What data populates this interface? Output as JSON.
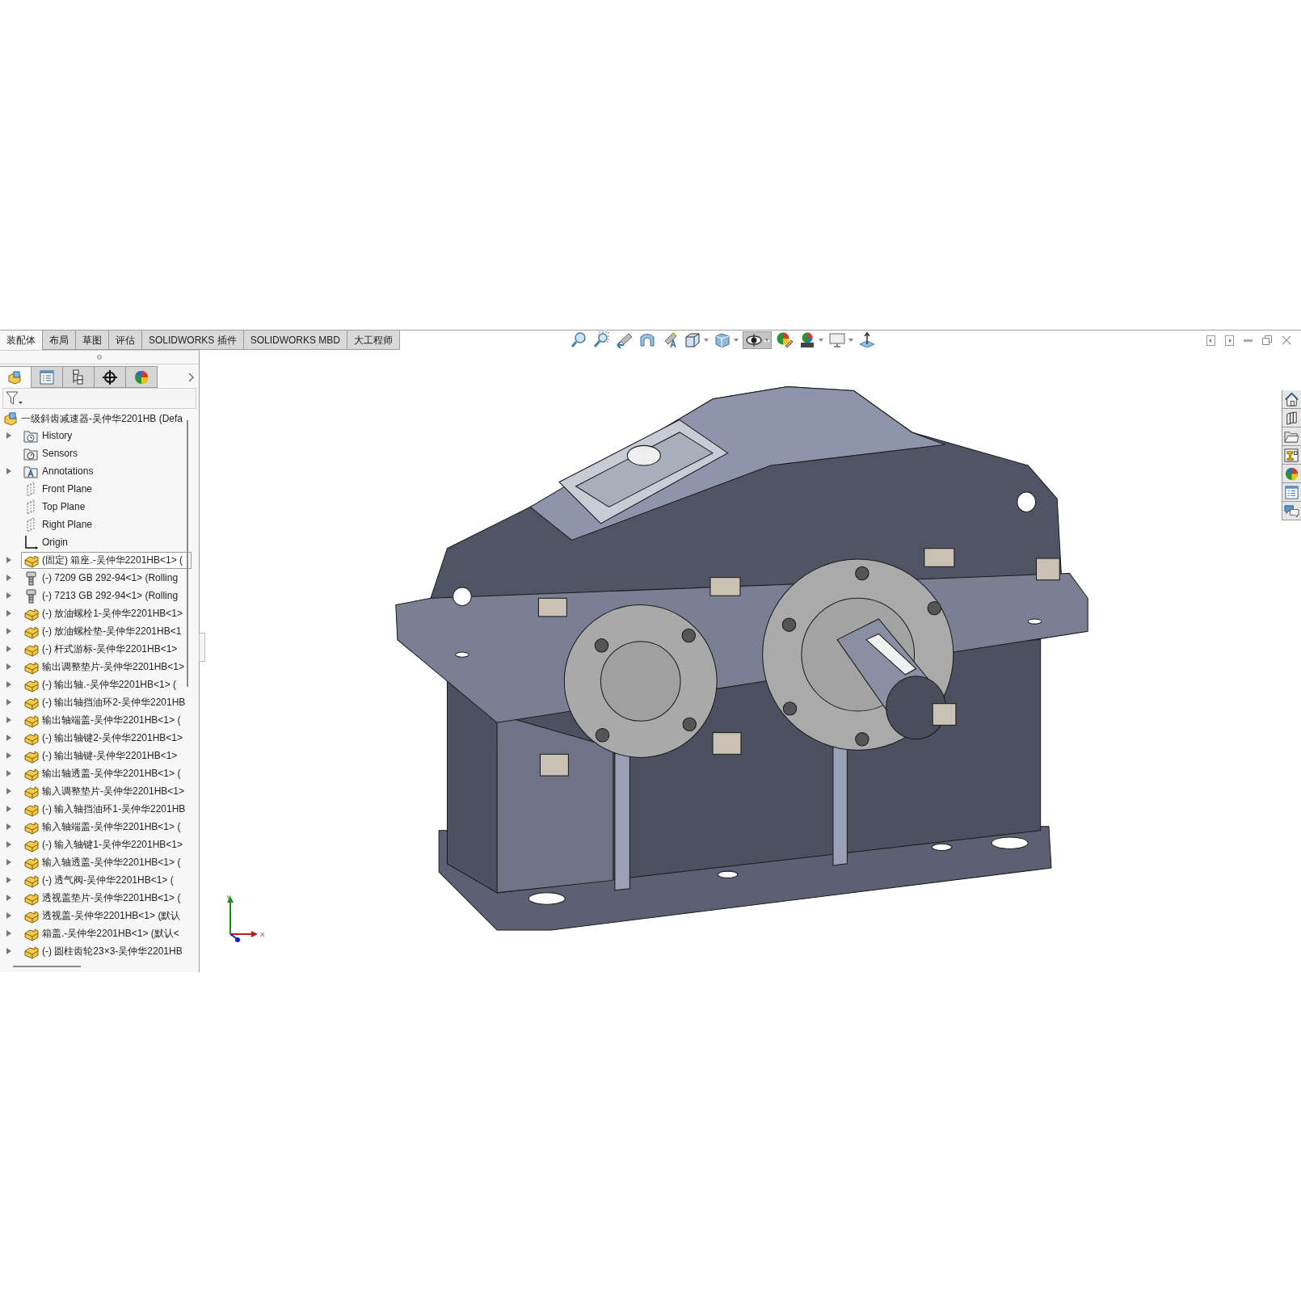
{
  "ribbon_tabs": [
    {
      "label": "装配体",
      "selected": true
    },
    {
      "label": "布局",
      "selected": false
    },
    {
      "label": "草图",
      "selected": false
    },
    {
      "label": "评估",
      "selected": false
    },
    {
      "label": "SOLIDWORKS 插件",
      "selected": false
    },
    {
      "label": "SOLIDWORKS MBD",
      "selected": false
    },
    {
      "label": "大工程师",
      "selected": false
    }
  ],
  "view_toolbar": [
    {
      "kind": "zoom-fit",
      "dropdown": false,
      "pressed": false
    },
    {
      "kind": "zoom-area",
      "dropdown": false,
      "pressed": false
    },
    {
      "kind": "previous-view",
      "dropdown": false,
      "pressed": false
    },
    {
      "kind": "section-view",
      "dropdown": false,
      "pressed": false
    },
    {
      "kind": "annotation-view",
      "dropdown": false,
      "pressed": false
    },
    {
      "kind": "view-orientation",
      "dropdown": true,
      "pressed": false
    },
    {
      "kind": "display-style",
      "dropdown": true,
      "pressed": false
    },
    {
      "kind": "hide-show",
      "dropdown": true,
      "pressed": true
    },
    {
      "kind": "edit-appearance",
      "dropdown": false,
      "pressed": false
    },
    {
      "kind": "apply-scene",
      "dropdown": true,
      "pressed": false
    },
    {
      "kind": "view-settings",
      "dropdown": true,
      "pressed": false
    },
    {
      "kind": "normal-to",
      "dropdown": false,
      "pressed": false
    }
  ],
  "panel_tabs": [
    {
      "kind": "feature-tree",
      "selected": true
    },
    {
      "kind": "property",
      "selected": false
    },
    {
      "kind": "configuration",
      "selected": false
    },
    {
      "kind": "dimxpert",
      "selected": false
    },
    {
      "kind": "display",
      "selected": false
    }
  ],
  "tree": {
    "label": "一级斜齿减速器-吴仲华2201HB (Defa",
    "kind": "assembly",
    "children": [
      {
        "label": "History",
        "kind": "history",
        "expandable": true,
        "selected": false
      },
      {
        "label": "Sensors",
        "kind": "sensors",
        "expandable": false,
        "selected": false
      },
      {
        "label": "Annotations",
        "kind": "annotations",
        "expandable": true,
        "selected": false
      },
      {
        "label": "Front Plane",
        "kind": "plane",
        "expandable": false,
        "selected": false
      },
      {
        "label": "Top Plane",
        "kind": "plane",
        "expandable": false,
        "selected": false
      },
      {
        "label": "Right Plane",
        "kind": "plane",
        "expandable": false,
        "selected": false
      },
      {
        "label": "Origin",
        "kind": "origin",
        "expandable": false,
        "selected": false
      },
      {
        "label": "(固定) 箱座.-吴仲华2201HB<1> (",
        "kind": "part",
        "expandable": true,
        "selected": true
      },
      {
        "label": "(-) 7209 GB 292-94<1> (Rolling",
        "kind": "bearing",
        "expandable": true,
        "selected": false
      },
      {
        "label": "(-) 7213 GB 292-94<1> (Rolling",
        "kind": "bearing",
        "expandable": true,
        "selected": false
      },
      {
        "label": "(-) 放油螺栓1-吴仲华2201HB<1>",
        "kind": "part",
        "expandable": true,
        "selected": false
      },
      {
        "label": "(-) 放油螺栓垫-吴仲华2201HB<1",
        "kind": "part",
        "expandable": true,
        "selected": false
      },
      {
        "label": "(-) 杆式游标-吴仲华2201HB<1>",
        "kind": "part",
        "expandable": true,
        "selected": false
      },
      {
        "label": "输出调整垫片-吴仲华2201HB<1>",
        "kind": "part",
        "expandable": true,
        "selected": false
      },
      {
        "label": "(-) 输出轴.-吴仲华2201HB<1> (",
        "kind": "part",
        "expandable": true,
        "selected": false
      },
      {
        "label": "(-) 输出轴挡油环2-吴仲华2201HB",
        "kind": "part",
        "expandable": true,
        "selected": false
      },
      {
        "label": "输出轴端盖-吴仲华2201HB<1> (",
        "kind": "part",
        "expandable": true,
        "selected": false
      },
      {
        "label": "(-) 输出轴键2-吴仲华2201HB<1>",
        "kind": "part",
        "expandable": true,
        "selected": false
      },
      {
        "label": "(-) 输出轴键-吴仲华2201HB<1>",
        "kind": "part",
        "expandable": true,
        "selected": false
      },
      {
        "label": "输出轴透盖-吴仲华2201HB<1> (",
        "kind": "part",
        "expandable": true,
        "selected": false
      },
      {
        "label": "输入调整垫片-吴仲华2201HB<1>",
        "kind": "part",
        "expandable": true,
        "selected": false
      },
      {
        "label": "(-) 输入轴挡油环1-吴仲华2201HB",
        "kind": "part",
        "expandable": true,
        "selected": false
      },
      {
        "label": "输入轴端盖-吴仲华2201HB<1> (",
        "kind": "part",
        "expandable": true,
        "selected": false
      },
      {
        "label": "(-) 输入轴键1-吴仲华2201HB<1>",
        "kind": "part",
        "expandable": true,
        "selected": false
      },
      {
        "label": "输入轴透盖-吴仲华2201HB<1> (",
        "kind": "part",
        "expandable": true,
        "selected": false
      },
      {
        "label": "(-) 透气阀-吴仲华2201HB<1> (",
        "kind": "part",
        "expandable": true,
        "selected": false
      },
      {
        "label": "透视盖垫片-吴仲华2201HB<1> (",
        "kind": "part",
        "expandable": true,
        "selected": false
      },
      {
        "label": "透视盖-吴仲华2201HB<1> (默认",
        "kind": "part",
        "expandable": true,
        "selected": false
      },
      {
        "label": "箱盖.-吴仲华2201HB<1> (默认<",
        "kind": "part",
        "expandable": true,
        "selected": false
      },
      {
        "label": "(-) 圆柱齿轮23×3-吴仲华2201HB",
        "kind": "part",
        "expandable": true,
        "selected": false
      }
    ]
  },
  "triad": {
    "y_label": "Y",
    "x_label": "X"
  },
  "task_pane": [
    {
      "kind": "home"
    },
    {
      "kind": "library"
    },
    {
      "kind": "file-explorer"
    },
    {
      "kind": "view-palette"
    },
    {
      "kind": "appearances"
    },
    {
      "kind": "custom-properties"
    },
    {
      "kind": "forum"
    }
  ]
}
